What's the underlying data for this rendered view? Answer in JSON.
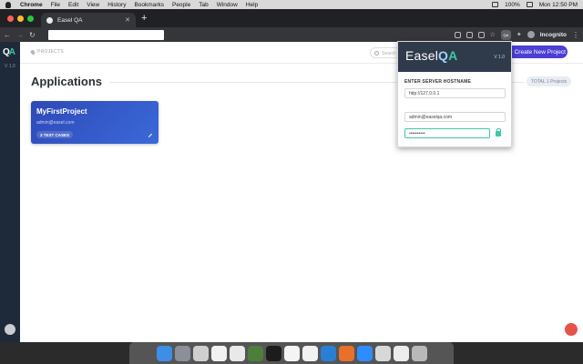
{
  "menubar": {
    "app": "Chrome",
    "items": [
      "File",
      "Edit",
      "View",
      "History",
      "Bookmarks",
      "People",
      "Tab",
      "Window",
      "Help"
    ],
    "battery": "100%",
    "clock": "Mon 12:50 PM"
  },
  "browser": {
    "tab_title": "Easel QA",
    "new_tab": "+",
    "profile": "Incognito"
  },
  "sidebar": {
    "logo_q": "Q",
    "logo_a": "A",
    "version": "V 1.0"
  },
  "topbar": {
    "breadcrumb": "PROJECTS",
    "search_placeholder": "Search",
    "create_button": "+ Create New Project"
  },
  "main": {
    "title": "Applications",
    "total_badge": "TOTAL 1 Projects",
    "project": {
      "name": "MyFirstProject",
      "email": "admin@easel.com",
      "test_cases": "3 TEST CASES"
    }
  },
  "popup": {
    "brand_easel": "Easel",
    "brand_q": "Q",
    "brand_a": "A",
    "version": "V 1.0",
    "hostname_label": "ENTER SERVER HOSTNAME",
    "hostname_value": "http://127.0.0.1",
    "email_value": "admin@easelqa.com",
    "password_value": "••••••••••"
  },
  "colors": {
    "accent": "#4b3fd6",
    "sidebar": "#1e2a3a",
    "teal": "#3cc9a5"
  }
}
